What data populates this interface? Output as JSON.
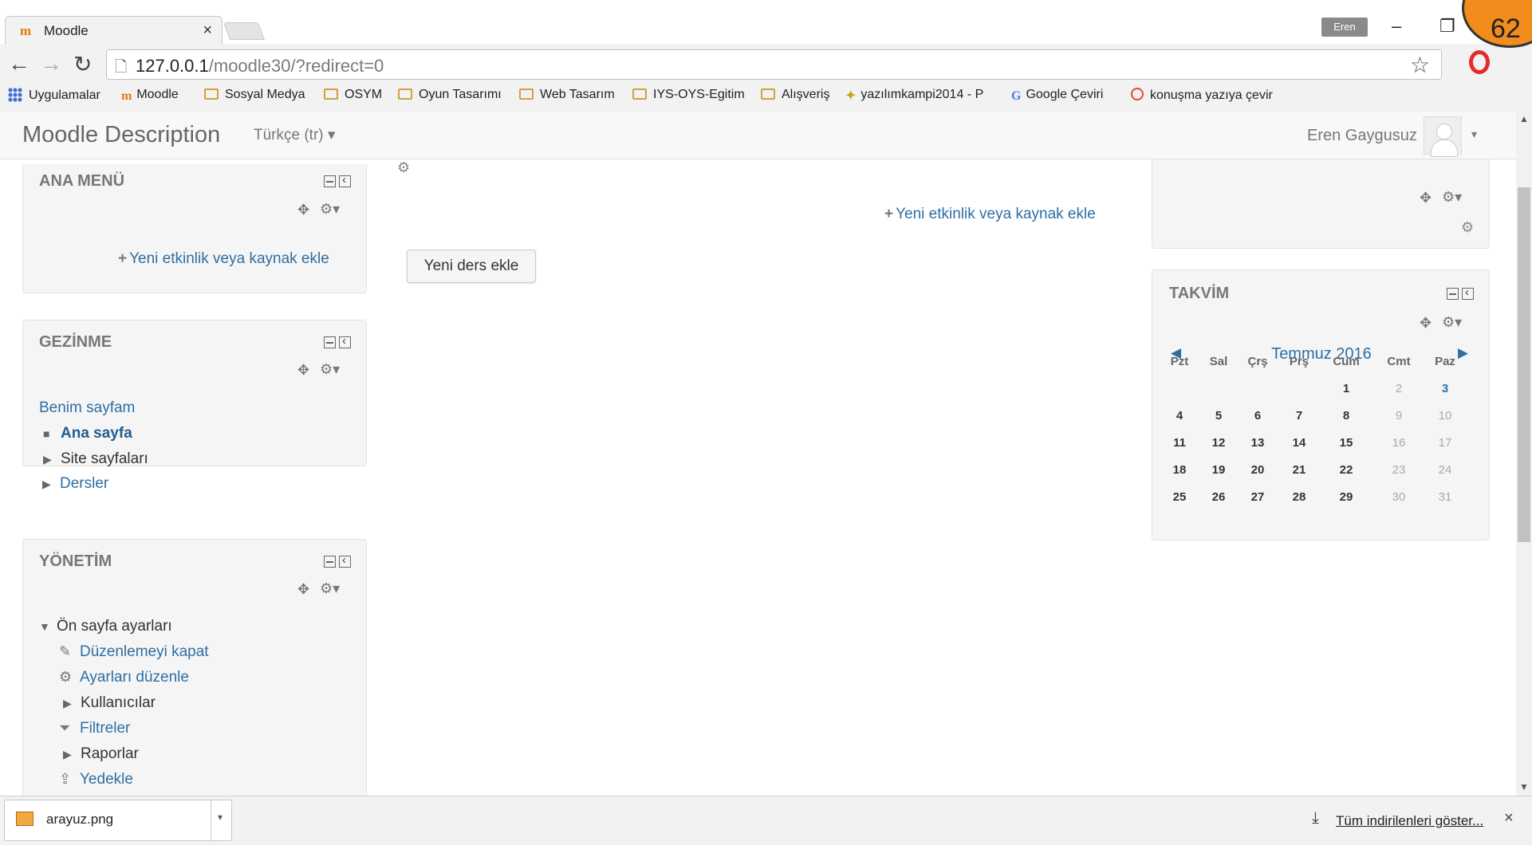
{
  "browser": {
    "tab_title": "Moodle",
    "tab_close": "×",
    "favicon": "m",
    "user_chip": "Eren",
    "badge_number": "62",
    "url_host": "127.0.0.1",
    "url_rest": "/moodle30/?redirect=0",
    "icons": {
      "back": "←",
      "forward": "→",
      "reload": "↻",
      "star": "☆",
      "minimize": "–",
      "restore": "❐"
    },
    "bookmarks": [
      {
        "label": "Uygulamalar",
        "icon": "apps-icon"
      },
      {
        "label": "Moodle",
        "icon": "moodle-icon"
      },
      {
        "label": "Sosyal Medya",
        "icon": "folder-icon"
      },
      {
        "label": "OSYM",
        "icon": "folder-icon"
      },
      {
        "label": "Oyun Tasarımı",
        "icon": "folder-icon"
      },
      {
        "label": "Web Tasarım",
        "icon": "folder-icon"
      },
      {
        "label": "IYS-OYS-Egitim",
        "icon": "folder-icon"
      },
      {
        "label": "Alışveriş",
        "icon": "folder-icon"
      },
      {
        "label": "yazılımkampi2014 - P",
        "icon": "bird-icon"
      },
      {
        "label": "Google Çeviri",
        "icon": "translate-icon"
      },
      {
        "label": "konuşma yazıya çevir",
        "icon": "chrome-icon"
      }
    ]
  },
  "navbar": {
    "site_name": "Moodle Description",
    "language": "Türkçe (tr) ▾",
    "user_name": "Eren Gaygusuz",
    "user_caret": "▾"
  },
  "blocks": {
    "main_menu": {
      "title": "ANA MENÜ",
      "add_activity": "Yeni etkinlik veya kaynak ekle"
    },
    "navigation": {
      "title": "GEZİNME",
      "items": [
        "Benim sayfam",
        "Ana sayfa",
        "Site sayfaları",
        "Dersler"
      ]
    },
    "administration": {
      "title": "YÖNETİM",
      "items": [
        "Ön sayfa ayarları",
        "Düzenlemeyi kapat",
        "Ayarları düzenle",
        "Kullanıcılar",
        "Filtreler",
        "Raporlar",
        "Yedekle"
      ]
    },
    "calendar": {
      "title": "TAKVİM",
      "month": "Temmuz 2016",
      "prev": "◀",
      "next": "▶",
      "weekdays": [
        "Pzt",
        "Sal",
        "Çrş",
        "Prş",
        "Cum",
        "Cmt",
        "Paz"
      ],
      "first_weekday_index": 4,
      "days_in_month": 31,
      "linked_days": [
        3
      ]
    }
  },
  "center": {
    "add_activity": "Yeni etkinlik veya kaynak ekle",
    "new_course_button": "Yeni ders ekle"
  },
  "download_bar": {
    "file_name": "arayuz.png",
    "show_all": "Tüm indirilenleri göster...",
    "close": "×"
  },
  "colors": {
    "link": "#2f6ea2",
    "badge": "#f18c1d",
    "block_bg": "#f5f5f5"
  }
}
